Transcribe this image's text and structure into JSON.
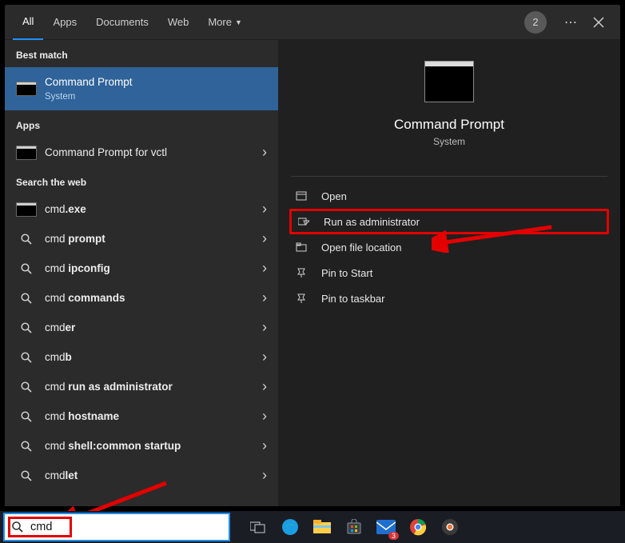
{
  "tabs": {
    "items": [
      "All",
      "Apps",
      "Documents",
      "Web",
      "More"
    ],
    "active_index": 0,
    "badge": "2"
  },
  "left": {
    "best_match_label": "Best match",
    "best_match": {
      "title": "Command Prompt",
      "subtitle": "System"
    },
    "apps_label": "Apps",
    "apps": [
      {
        "title_html": "Command Prompt for vctl"
      }
    ],
    "web_label": "Search the web",
    "web": [
      {
        "title_html": "cmd<b>.exe</b>",
        "icon": "cmd"
      },
      {
        "title_html": "cmd <b>prompt</b>",
        "icon": "search"
      },
      {
        "title_html": "cmd <b>ipconfig</b>",
        "icon": "search"
      },
      {
        "title_html": "cmd <b>commands</b>",
        "icon": "search"
      },
      {
        "title_html": "cmd<b>er</b>",
        "icon": "search"
      },
      {
        "title_html": "cmd<b>b</b>",
        "icon": "search"
      },
      {
        "title_html": "cmd <b>run as administrator</b>",
        "icon": "search"
      },
      {
        "title_html": "cmd <b>hostname</b>",
        "icon": "search"
      },
      {
        "title_html": "cmd <b>shell:common startup</b>",
        "icon": "search"
      },
      {
        "title_html": "cmd<b>let</b>",
        "icon": "search"
      }
    ]
  },
  "preview": {
    "title": "Command Prompt",
    "subtitle": "System",
    "actions": [
      {
        "name": "open",
        "label": "Open"
      },
      {
        "name": "run-as-admin",
        "label": "Run as administrator",
        "highlight": true
      },
      {
        "name": "open-file-location",
        "label": "Open file location"
      },
      {
        "name": "pin-to-start",
        "label": "Pin to Start"
      },
      {
        "name": "pin-to-taskbar",
        "label": "Pin to taskbar"
      }
    ]
  },
  "searchbox": {
    "value": "cmd"
  },
  "taskbar": {
    "mail_badge": "3"
  },
  "annotations": {
    "highlight_color": "#e30000"
  }
}
